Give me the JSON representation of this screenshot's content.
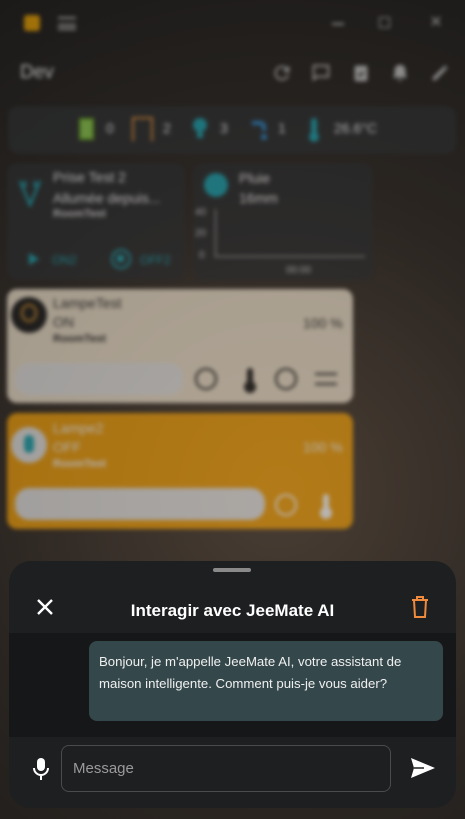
{
  "window": {
    "minimize_glyph": "",
    "maximize_glyph": "",
    "close_glyph": "✕"
  },
  "header": {
    "title": "Dev"
  },
  "status": {
    "windows_count": "0",
    "doors_count": "2",
    "lights_count": "3",
    "water_count": "1",
    "temperature": "26.6°C"
  },
  "cards": {
    "prise": {
      "name": "Prise Test 2",
      "status": "Allumée depuis...",
      "room": "RoomTest",
      "on_label": "ON2",
      "off_label": "OFF2"
    },
    "pluie": {
      "name": "Pluie",
      "value": "16mm",
      "y_ticks": [
        "40",
        "20",
        "0"
      ],
      "x_tick": "00:00"
    },
    "lampetest": {
      "name": "LampeTest",
      "state": "ON",
      "room": "RoomTest",
      "percent": "100 %"
    },
    "lampe2": {
      "name": "Lampe2",
      "state": "OFF",
      "room": "RoomTest",
      "percent": "100 %"
    }
  },
  "chat": {
    "title": "Interagir avec JeeMate AI",
    "greeting": "Bonjour, je m'appelle JeeMate AI, votre assistant de maison intelligente. Comment puis-je vous aider?",
    "input_placeholder": "Message"
  },
  "colors": {
    "accent_orange": "#f3a008",
    "teal": "#1aa7b5",
    "trash": "#f08a3c",
    "bubble": "#34474b"
  }
}
